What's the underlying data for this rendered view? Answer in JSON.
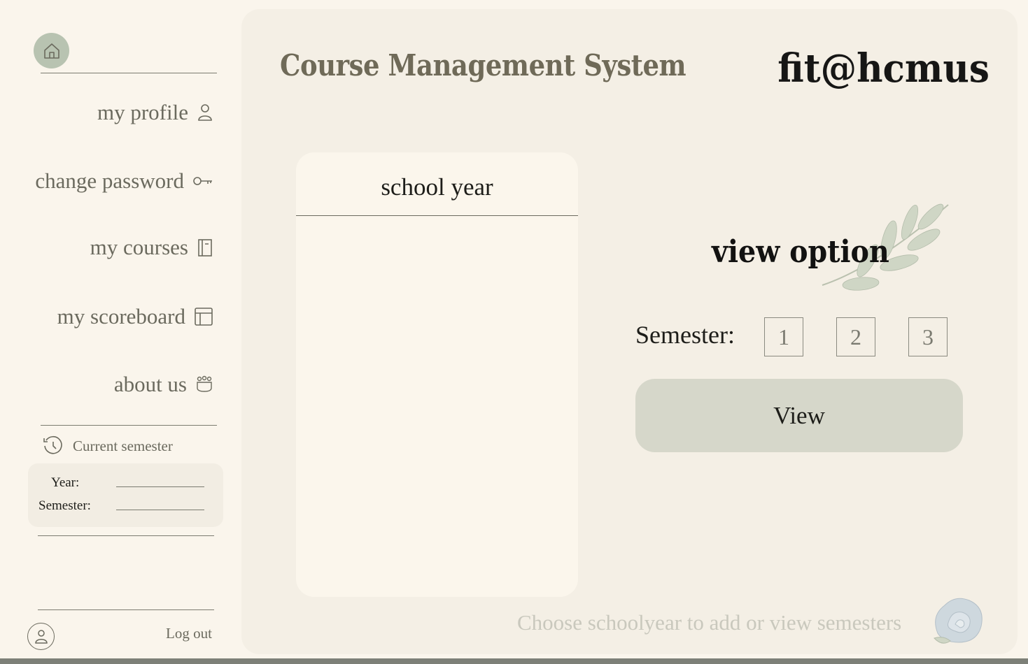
{
  "sidebar": {
    "nav": [
      {
        "label": "my profile",
        "icon": "user-icon"
      },
      {
        "label": "change password",
        "icon": "key-icon"
      },
      {
        "label": "my courses",
        "icon": "notebook-icon"
      },
      {
        "label": "my scoreboard",
        "icon": "table-icon"
      },
      {
        "label": "about us",
        "icon": "team-icon"
      }
    ],
    "current_semester": {
      "title": "Current semester",
      "year_label": "Year:",
      "semester_label": "Semester:"
    },
    "logout_label": "Log out"
  },
  "header": {
    "title": "Course Management System",
    "brand": "fit@hcmus"
  },
  "school_year_panel": {
    "title": "school year"
  },
  "view_option": {
    "title": "view option",
    "semester_label": "Semester:",
    "semesters": [
      "1",
      "2",
      "3"
    ],
    "view_button": "View"
  },
  "hint": "Choose schoolyear to add or view semesters",
  "colors": {
    "background": "#faf5ec",
    "panel": "#f4efe5",
    "accent_green": "#b8c3b1",
    "button": "#d6d7ca",
    "text_muted": "#6b6a5e"
  }
}
